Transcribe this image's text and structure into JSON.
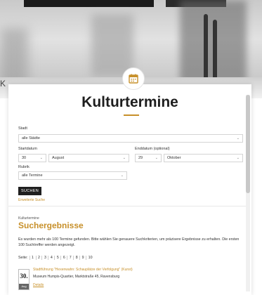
{
  "background": {
    "edge_letter": "K"
  },
  "modal": {
    "title": "Kulturtermine",
    "icon": "calendar-icon",
    "accent_color": "#c7902a"
  },
  "form": {
    "stadt_label": "Stadt",
    "stadt_value": "alle Städte",
    "startdatum_label": "Startdatum",
    "start_day": "30",
    "start_month": "August",
    "enddatum_label": "Enddatum (optional)",
    "end_day": "29",
    "end_month": "Oktober",
    "rubrik_label": "Rubrik",
    "rubrik_value": "alle Termine",
    "submit_label": "SUCHEN",
    "extended_search": "Erweiterte Suche"
  },
  "results": {
    "kicker": "Kulturtermine",
    "title": "Suchergebnisse",
    "info": "Es wurden mehr als 100 Termine gefunden. Bitte wählen Sie genauere Suchkriterien, um präzisere Ergebnisse zu erhalten. Die ersten 100 Suchtreffer werden angezeigt.",
    "pages_label": "Seite:",
    "pages": [
      "1",
      "2",
      "3",
      "4",
      "5",
      "6",
      "7",
      "8",
      "9",
      "10"
    ]
  },
  "event": {
    "day": "30.",
    "month": "Aug",
    "title": "Stadtführung \"Hexenwahn: Schauplätze der Verfolgung\" (Kunst)",
    "place": "Museum Humpis-Quartier, Marktstraße 45, Ravensburg",
    "details": "Details"
  }
}
